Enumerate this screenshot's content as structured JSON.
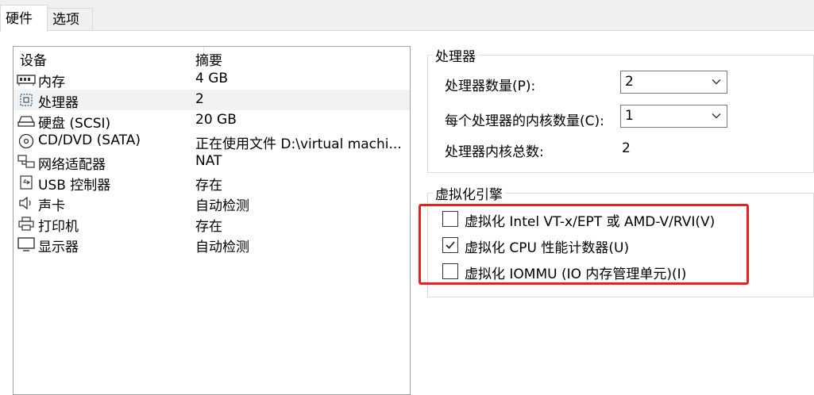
{
  "tabs": [
    {
      "label": "硬件"
    },
    {
      "label": "选项"
    }
  ],
  "device_list": {
    "headers": {
      "device": "设备",
      "summary": "摘要"
    },
    "rows": [
      {
        "name": "内存",
        "summary": "4 GB",
        "icon": "memory-icon"
      },
      {
        "name": "处理器",
        "summary": "2",
        "icon": "processor-icon",
        "selected": true
      },
      {
        "name": "硬盘 (SCSI)",
        "summary": "20 GB",
        "icon": "harddisk-icon"
      },
      {
        "name": "CD/DVD (SATA)",
        "summary": "正在使用文件 D:\\virtual machi...",
        "icon": "cd-dvd-icon"
      },
      {
        "name": "网络适配器",
        "summary": "NAT",
        "icon": "network-adapter-icon"
      },
      {
        "name": "USB 控制器",
        "summary": "存在",
        "icon": "usb-icon"
      },
      {
        "name": "声卡",
        "summary": "自动检测",
        "icon": "speaker-icon"
      },
      {
        "name": "打印机",
        "summary": "存在",
        "icon": "printer-icon"
      },
      {
        "name": "显示器",
        "summary": "自动检测",
        "icon": "monitor-icon"
      }
    ]
  },
  "processor_group": {
    "title": "处理器",
    "count_label": "处理器数量(P):",
    "count_value": "2",
    "cores_label": "每个处理器的内核数量(C):",
    "cores_value": "1",
    "total_label": "处理器内核总数:",
    "total_value": "2"
  },
  "virtualization_group": {
    "title": "虚拟化引擎",
    "options": [
      {
        "label": "虚拟化 Intel VT-x/EPT 或 AMD-V/RVI(V)",
        "checked": false
      },
      {
        "label": "虚拟化 CPU 性能计数器(U)",
        "checked": true
      },
      {
        "label": "虚拟化 IOMMU (IO 内存管理单元)(I)",
        "checked": false
      }
    ]
  },
  "colors": {
    "highlight": "#e52222",
    "selected_row": "#f2f2f2"
  }
}
